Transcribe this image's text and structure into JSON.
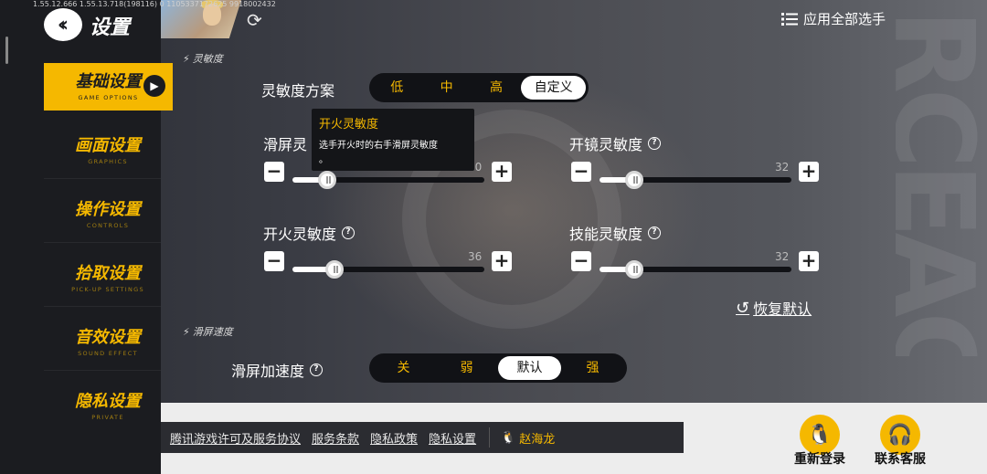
{
  "debug_text": "1.55.12.666  1.55.13.718(198116)  0  1105337172625  9918002432",
  "header": {
    "back_icon": "double-chevron-left-icon",
    "title": "设置",
    "refresh_icon": "refresh-icon",
    "select_all": "应用全部选手"
  },
  "sidebar": {
    "items": [
      {
        "cn": "基础设置",
        "en": "GAME OPTIONS",
        "active": true
      },
      {
        "cn": "画面设置",
        "en": "GRAPHICS"
      },
      {
        "cn": "操作设置",
        "en": "CONTROLS"
      },
      {
        "cn": "拾取设置",
        "en": "PICK-UP SETTINGS"
      },
      {
        "cn": "音效设置",
        "en": "SOUND EFFECT"
      },
      {
        "cn": "隐私设置",
        "en": "PRIVATE"
      }
    ]
  },
  "sensitivity": {
    "section_label": "灵敏度",
    "scheme_label": "灵敏度方案",
    "scheme_options": [
      "低",
      "中",
      "高",
      "自定义"
    ],
    "scheme_selected": "自定义",
    "sliders": [
      {
        "label": "滑屏灵",
        "value": "30",
        "fraction": 0.18
      },
      {
        "label": "开镜灵敏度",
        "value": "32",
        "fraction": 0.18
      },
      {
        "label": "开火灵敏度",
        "value": "36",
        "fraction": 0.22
      },
      {
        "label": "技能灵敏度",
        "value": "32",
        "fraction": 0.18
      }
    ],
    "restore": "恢复默认"
  },
  "tooltip": {
    "title": "开火灵敏度",
    "desc": "选手开火时的右手滑屏灵敏度",
    "desc2": "。"
  },
  "swipe": {
    "section_label": "滑屏速度",
    "accel_label": "滑屏加速度",
    "options": [
      "关",
      "弱",
      "默认",
      "强"
    ],
    "selected": "默认"
  },
  "footer": {
    "links": [
      "腾讯游戏许可及服务协议",
      "服务条款",
      "隐私政策",
      "隐私设置"
    ],
    "user_name": "赵海龙",
    "relogin": "重新登录",
    "support": "联系客服"
  },
  "colors": {
    "accent": "#f5b800",
    "sidebar": "#1b1c20"
  }
}
